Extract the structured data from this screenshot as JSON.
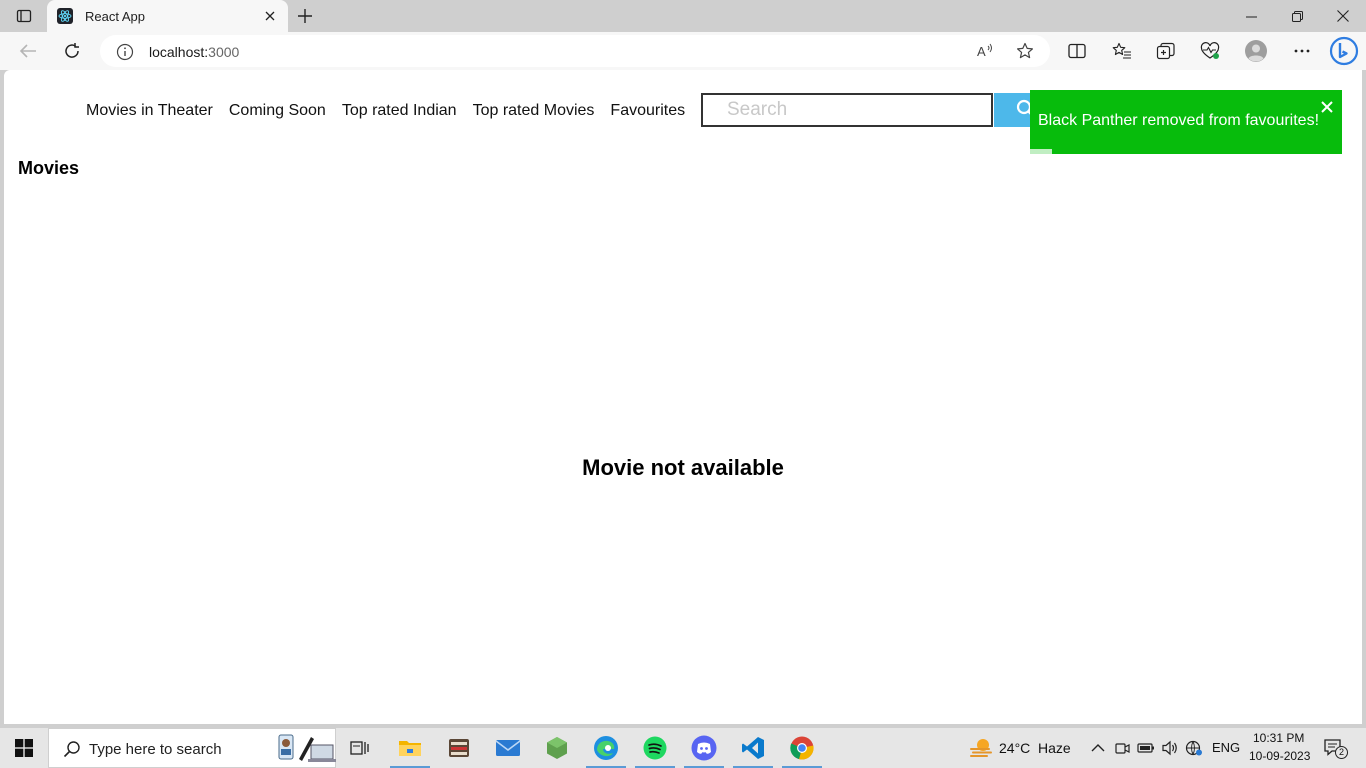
{
  "browser": {
    "tab_title": "React App",
    "url_host": "localhost:",
    "url_port": "3000"
  },
  "page": {
    "nav": [
      {
        "label": "Movies in Theater"
      },
      {
        "label": "Coming Soon"
      },
      {
        "label": "Top rated Indian"
      },
      {
        "label": "Top rated Movies"
      },
      {
        "label": "Favourites"
      }
    ],
    "search_placeholder": "Search",
    "section_title": "Movies",
    "empty_message": "Movie not available",
    "toast": {
      "message": "Black Panther removed from favourites!",
      "color": "#07bc0c",
      "progress": 0.07
    },
    "accent_color": "#4db8ea"
  },
  "taskbar": {
    "search_placeholder": "Type here to search",
    "apps": [
      "task-view",
      "file-explorer",
      "media-app",
      "mail",
      "node-app",
      "edge",
      "spotify",
      "discord",
      "vscode",
      "chrome"
    ],
    "weather": {
      "temp": "24°C",
      "condition": "Haze"
    },
    "language": "ENG",
    "time": "10:31 PM",
    "date": "10-09-2023",
    "notification_count": "2"
  }
}
